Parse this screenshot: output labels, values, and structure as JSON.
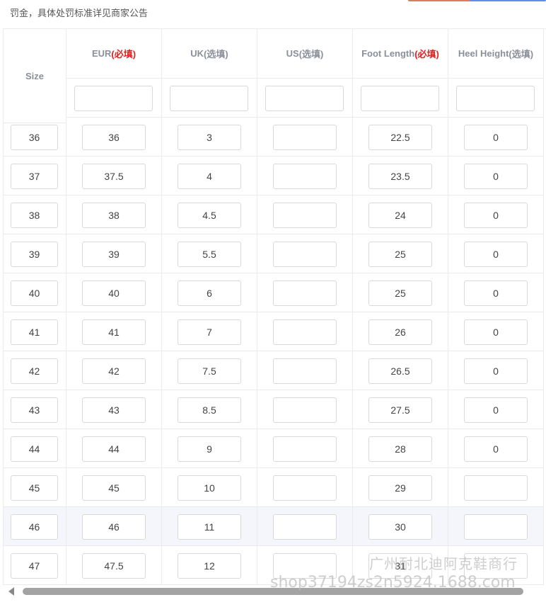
{
  "notice": "罚金，具体处罚标准详见商家公告",
  "colors": {
    "header_text": "#8a8f99",
    "required_mark": "#e02020",
    "border": "#ebebeb",
    "input_border": "#d9d9d9",
    "highlight_row": "#f4f6fb",
    "scroll_thumb": "#a3a3a3"
  },
  "table": {
    "size_header": "Size",
    "columns": [
      {
        "name": "EUR",
        "tag": "(必填)",
        "required": true
      },
      {
        "name": "UK",
        "tag": "(选填)",
        "required": false
      },
      {
        "name": "US",
        "tag": "(选填)",
        "required": false
      },
      {
        "name": "Foot Length",
        "tag": "(必填)",
        "required": true
      },
      {
        "name": "Heel Height",
        "tag": "(选填)",
        "required": false
      }
    ],
    "header_inputs": [
      "",
      "",
      "",
      "",
      ""
    ],
    "rows": [
      {
        "size": "36",
        "values": [
          "36",
          "3",
          "",
          "22.5",
          "0"
        ]
      },
      {
        "size": "37",
        "values": [
          "37.5",
          "4",
          "",
          "23.5",
          "0"
        ]
      },
      {
        "size": "38",
        "values": [
          "38",
          "4.5",
          "",
          "24",
          "0"
        ]
      },
      {
        "size": "39",
        "values": [
          "39",
          "5.5",
          "",
          "25",
          "0"
        ]
      },
      {
        "size": "40",
        "values": [
          "40",
          "6",
          "",
          "25",
          "0"
        ]
      },
      {
        "size": "41",
        "values": [
          "41",
          "7",
          "",
          "26",
          "0"
        ]
      },
      {
        "size": "42",
        "values": [
          "42",
          "7.5",
          "",
          "26.5",
          "0"
        ]
      },
      {
        "size": "43",
        "values": [
          "43",
          "8.5",
          "",
          "27.5",
          "0"
        ]
      },
      {
        "size": "44",
        "values": [
          "44",
          "9",
          "",
          "28",
          "0"
        ]
      },
      {
        "size": "45",
        "values": [
          "45",
          "10",
          "",
          "29",
          ""
        ]
      },
      {
        "size": "46",
        "values": [
          "46",
          "11",
          "",
          "30",
          ""
        ]
      },
      {
        "size": "47",
        "values": [
          "47.5",
          "12",
          "",
          "31",
          ""
        ]
      }
    ],
    "highlighted_row": 10
  },
  "watermark": {
    "line1": "广州耐北迪阿克鞋商行",
    "line2": "shop37194zs2n5924.1688.com"
  }
}
